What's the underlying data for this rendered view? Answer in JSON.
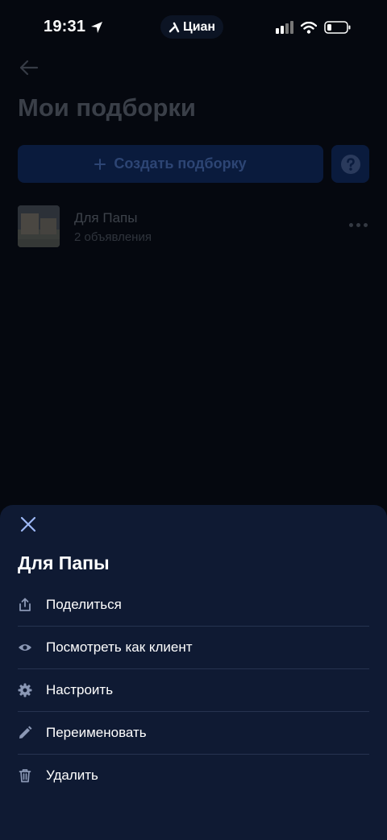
{
  "status_bar": {
    "time": "19:31",
    "app_pill": "Циан"
  },
  "page": {
    "title": "Мои подборки",
    "create_button": "Создать подборку"
  },
  "collections": [
    {
      "name": "Для Папы",
      "count": "2 объявления"
    }
  ],
  "sheet": {
    "title": "Для Папы",
    "items": [
      {
        "label": "Поделиться",
        "icon": "share-icon"
      },
      {
        "label": "Посмотреть как клиент",
        "icon": "eye-icon"
      },
      {
        "label": "Настроить",
        "icon": "gear-icon"
      },
      {
        "label": "Переименовать",
        "icon": "pencil-icon"
      },
      {
        "label": "Удалить",
        "icon": "trash-icon"
      }
    ]
  },
  "colors": {
    "sheet_bg": "#0f1a33",
    "page_bg": "#05080f",
    "accent": "#0a1b3d"
  }
}
